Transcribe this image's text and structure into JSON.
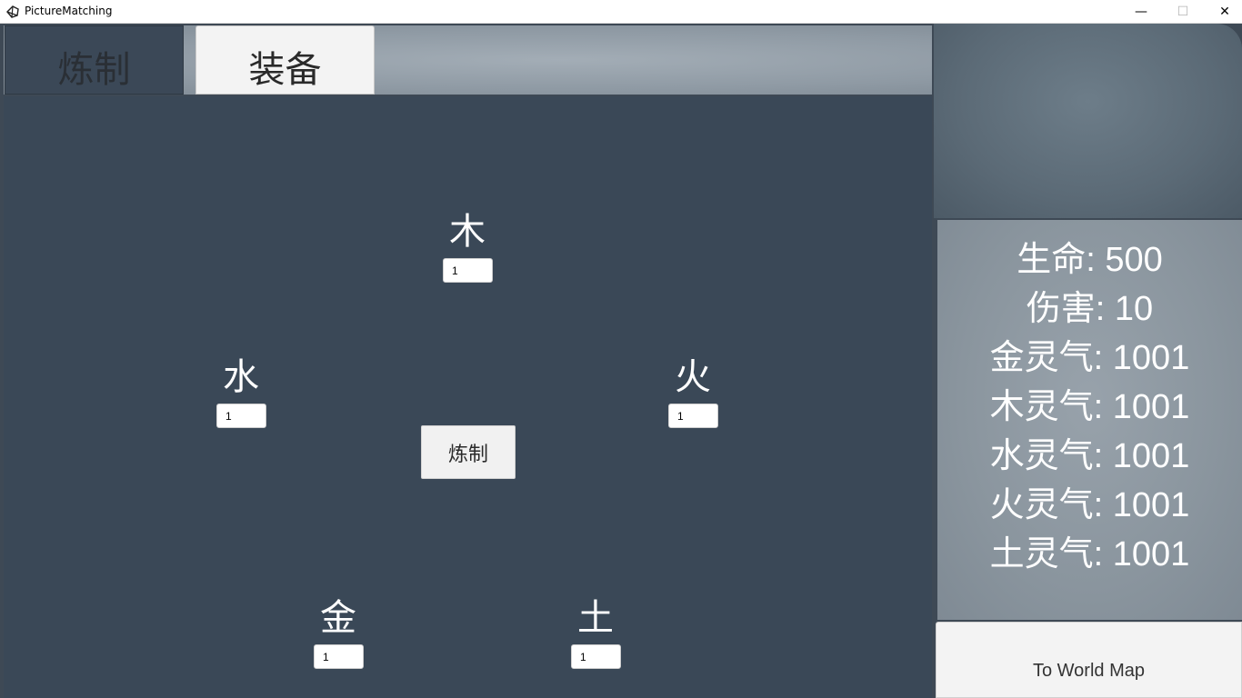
{
  "window": {
    "title": "PictureMatching",
    "minimize": "—",
    "maximize": "☐",
    "close": "✕"
  },
  "tabs": [
    {
      "label": "炼制",
      "active": false
    },
    {
      "label": "装备",
      "active": true
    }
  ],
  "elements": {
    "wood": {
      "label": "木",
      "value": "1"
    },
    "water": {
      "label": "水",
      "value": "1"
    },
    "fire": {
      "label": "火",
      "value": "1"
    },
    "metal": {
      "label": "金",
      "value": "1"
    },
    "earth": {
      "label": "土",
      "value": "1"
    }
  },
  "refine_button": "炼制",
  "stats": [
    "生命: 500",
    "伤害: 10",
    "金灵气: 1001",
    "木灵气: 1001",
    "水灵气: 1001",
    "火灵气: 1001",
    "土灵气: 1001"
  ],
  "world_map_button": "To World Map",
  "colors": {
    "panel": "#3a4857",
    "stats_bg": "#8a959e",
    "button_bg": "#f1f1f1"
  }
}
